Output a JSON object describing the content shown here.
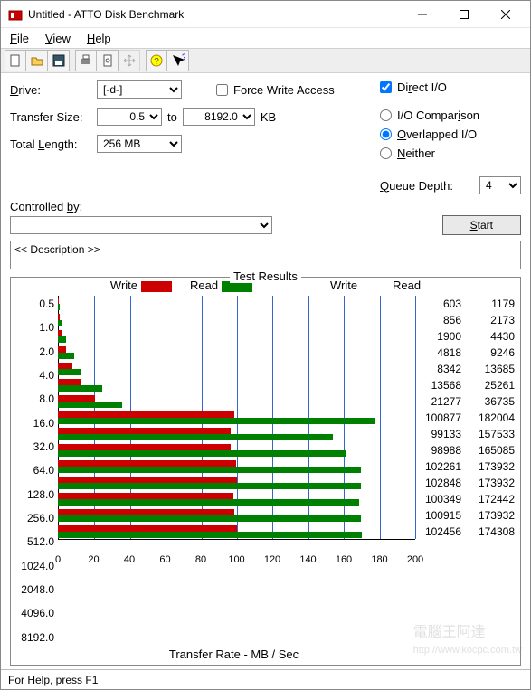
{
  "window": {
    "title": "Untitled - ATTO Disk Benchmark"
  },
  "menu": {
    "file": "File",
    "view": "View",
    "help": "Help"
  },
  "cfg": {
    "drive_label": "Drive:",
    "drive_value": "[-d-]",
    "tsize_label": "Transfer Size:",
    "tsize_from": "0.5",
    "tsize_to_label": "to",
    "tsize_to": "8192.0",
    "tsize_unit": "KB",
    "tlen_label": "Total Length:",
    "tlen_value": "256 MB",
    "force_label": "Force Write Access",
    "dio_label": "Direct I/O",
    "iocmp_label": "I/O Comparison",
    "overlap_label": "Overlapped I/O",
    "neither_label": "Neither",
    "qd_label": "Queue Depth:",
    "qd_value": "4",
    "ctrlby_label": "Controlled by:",
    "ctrlby_value": "",
    "start_label": "Start",
    "desc_value": "<< Description >>"
  },
  "results": {
    "title": "Test Results",
    "write_label": "Write",
    "read_label": "Read",
    "xaxis": "Transfer Rate - MB / Sec",
    "col_write": "Write",
    "col_read": "Read"
  },
  "chart_data": {
    "type": "bar",
    "orientation": "horizontal",
    "xlabel": "Transfer Rate - MB / Sec",
    "ylabel": "",
    "xlim": [
      0,
      200
    ],
    "x_ticks": [
      0,
      20,
      40,
      60,
      80,
      100,
      120,
      140,
      160,
      180,
      200
    ],
    "categories": [
      "0.5",
      "1.0",
      "2.0",
      "4.0",
      "8.0",
      "16.0",
      "32.0",
      "64.0",
      "128.0",
      "256.0",
      "512.0",
      "1024.0",
      "2048.0",
      "4096.0",
      "8192.0"
    ],
    "series": [
      {
        "name": "Write",
        "color": "#c00000",
        "unit": "KB/Sec",
        "values": [
          603,
          856,
          1900,
          4818,
          8342,
          13568,
          21277,
          100877,
          99133,
          98988,
          102261,
          102848,
          100349,
          100915,
          102456
        ]
      },
      {
        "name": "Read",
        "color": "#008000",
        "unit": "KB/Sec",
        "values": [
          1179,
          2173,
          4430,
          9246,
          13685,
          25261,
          36735,
          182004,
          157533,
          165085,
          173932,
          173932,
          172442,
          173932,
          174308
        ]
      }
    ]
  },
  "statusbar": {
    "text": "For Help, press F1"
  },
  "watermark": {
    "brand": "電腦王阿達",
    "url": "http://www.kocpc.com.tw"
  }
}
